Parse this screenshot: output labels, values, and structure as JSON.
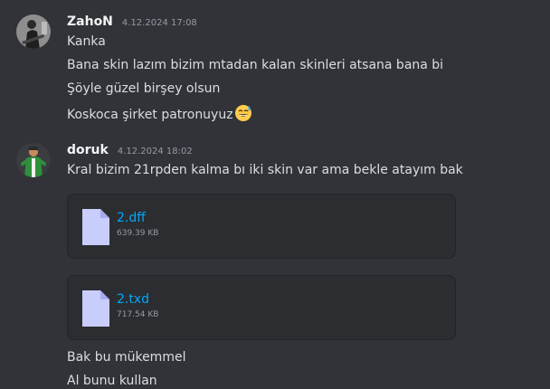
{
  "messages": [
    {
      "username": "ZahoN",
      "timestamp": "4.12.2024 17:08",
      "lines": [
        "Kanka",
        "Bana skin lazım bizim mtadan kalan skinleri atsana bana bi",
        "Şöyle güzel birşey olsun",
        "Koskoca şirket patronuyuz"
      ],
      "emoji": "grinning-sweat-emoji"
    },
    {
      "username": "doruk",
      "timestamp": "4.12.2024 18:02",
      "lines": [
        "Kral bizim 21rpden kalma bı iki skin var ama bekle atayım bak"
      ],
      "attachments": [
        {
          "name": "2.dff",
          "size": "639.39 KB",
          "icon": "file-icon"
        },
        {
          "name": "2.txd",
          "size": "717.54 KB",
          "icon": "file-icon"
        }
      ],
      "after_lines": [
        "Bak bu mükemmel",
        "Al bunu kullan"
      ]
    }
  ],
  "colors": {
    "background": "#313338",
    "attachment_bg": "#2b2d31",
    "link": "#00a8fc",
    "username": "#f2f3f5",
    "muted": "#949ba4"
  }
}
